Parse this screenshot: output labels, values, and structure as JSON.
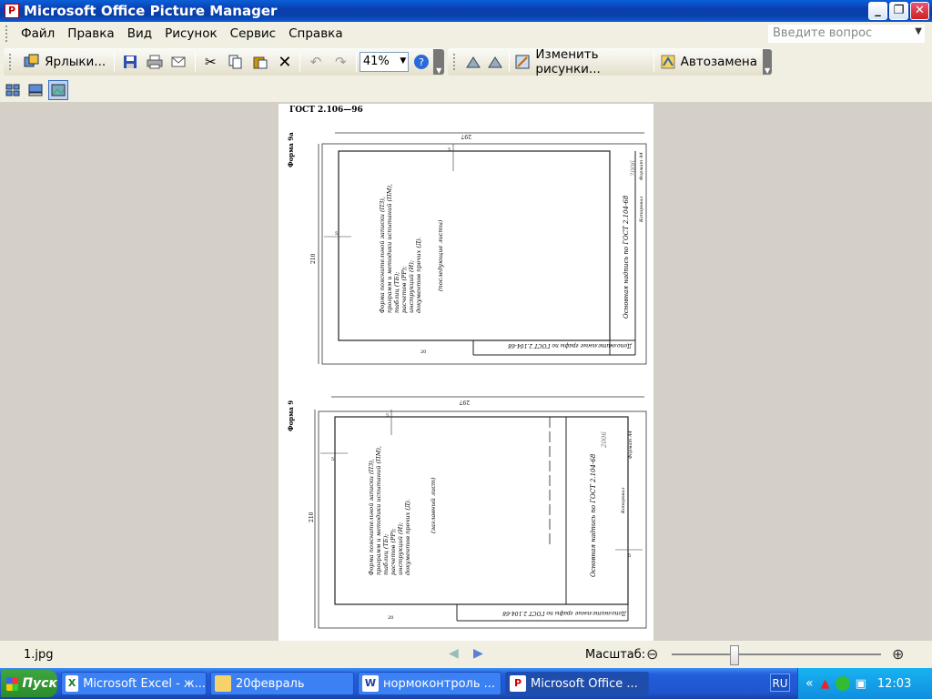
{
  "window": {
    "title": "Microsoft Office Picture Manager"
  },
  "menu": {
    "items": [
      "Файл",
      "Правка",
      "Вид",
      "Рисунок",
      "Сервис",
      "Справка"
    ],
    "ask_placeholder": "Введите вопрос"
  },
  "toolbar": {
    "shortcuts_label": "Ярлыки...",
    "zoom_value": "41%",
    "edit_pictures_label": "Изменить рисунки...",
    "autocorrect_label": "Автозамена"
  },
  "document": {
    "header": "ГОСТ 2.106—96",
    "form_a": {
      "label": "Форма 9а",
      "dim_width": "297",
      "dim_height": "210",
      "dim_top": "5",
      "dim_left": "5",
      "dim_bottom": "20",
      "text_lines": [
        "Форма пояснительной записки (ПЗ),",
        "программ и методики испытаний (ПМ),",
        "таблиц (ТБ);",
        "расчетов (РР);",
        "инструкций (И);",
        "документов прочих (Д)."
      ],
      "sheet_note": "(последующие листы)",
      "title_block": "Основная надпись по ГОСТ 2.104-68",
      "bottom_strip": "Дополнительные графы по ГОСТ 2.104-68",
      "copied": "Копировал",
      "format": "Формат А4",
      "year": "2006"
    },
    "form_b": {
      "label": "Форма 9",
      "dim_width": "297",
      "dim_height": "210",
      "dim_top": "5",
      "dim_left": "5",
      "dim_bottom": "20",
      "dim_right": "5",
      "text_lines": [
        "Форма пояснительной записки (ПЗ),",
        "программ и методики испытаний (ПМ),",
        "таблиц (ТБ);",
        "расчетов (РР);",
        "инструкций (И);",
        "документов прочих (Д)."
      ],
      "sheet_note": "(заглавный лист)",
      "title_block": "Основная надпись по ГОСТ 2.104-68",
      "bottom_strip": "Дополнительные графы по ГОСТ 2.104-68",
      "copied": "Копировал",
      "format": "Формат А4",
      "year": "2006"
    }
  },
  "status": {
    "filename": "1.jpg",
    "zoom_label": "Масштаб:"
  },
  "taskbar": {
    "start": "Пуск",
    "tasks": [
      "Microsoft Excel - ж...",
      "20февраль",
      "нормоконтроль ...",
      "Microsoft Office ..."
    ],
    "lang": "RU",
    "clock": "12:03"
  }
}
